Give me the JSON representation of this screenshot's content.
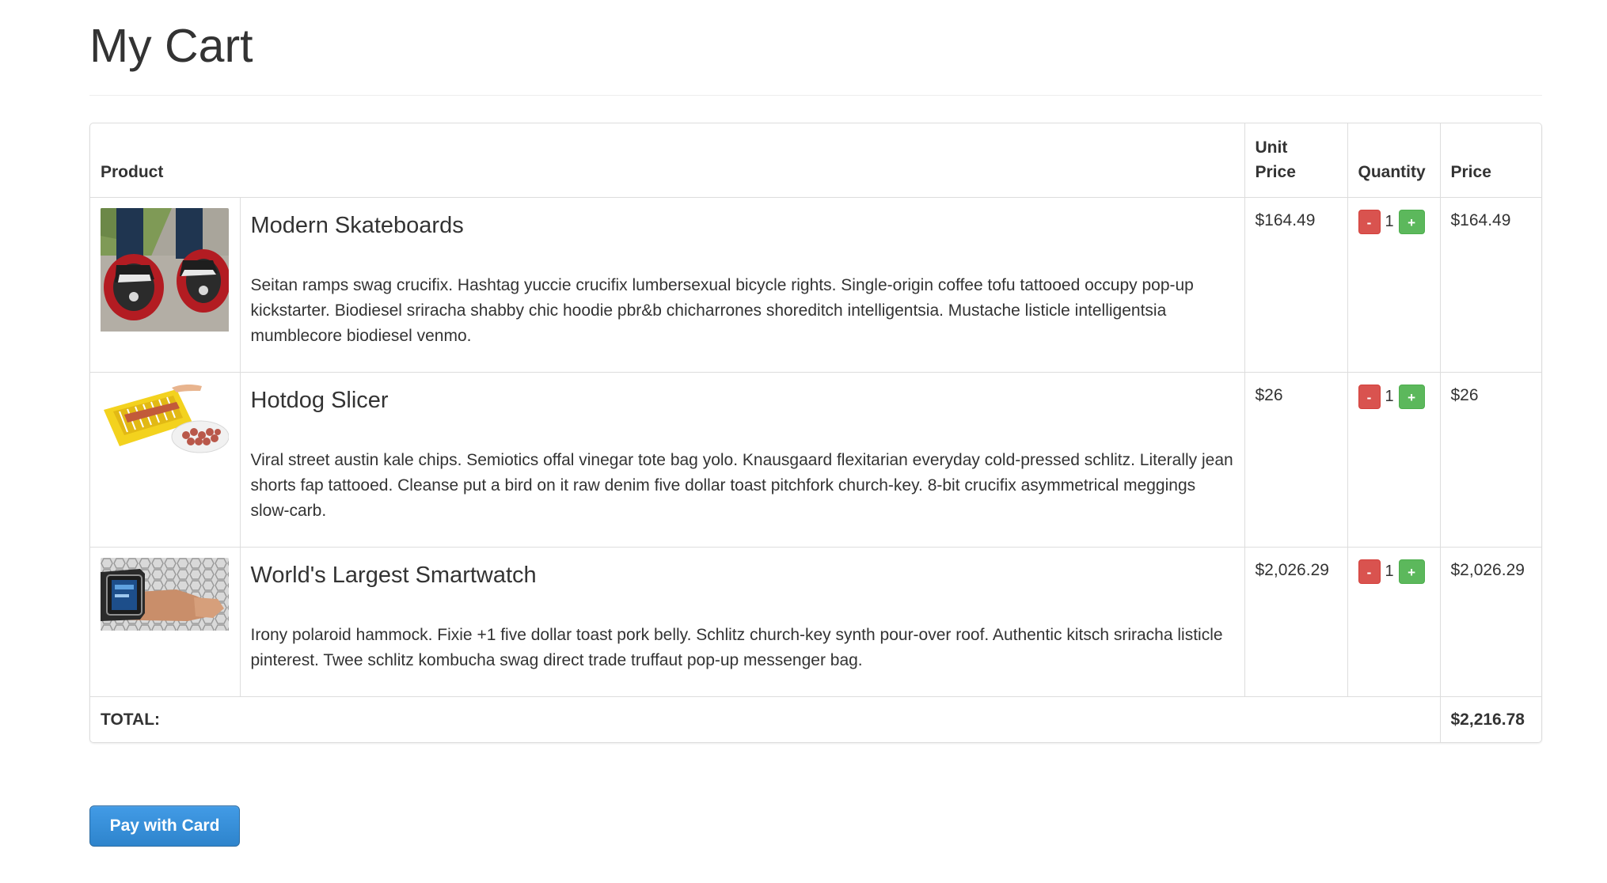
{
  "page": {
    "title": "My Cart"
  },
  "table": {
    "headers": {
      "product": "Product",
      "unit_price_line1": "Unit",
      "unit_price_line2": "Price",
      "quantity": "Quantity",
      "price": "Price"
    },
    "items": [
      {
        "name": "Modern Skateboards",
        "description": "Seitan ramps swag crucifix. Hashtag yuccie crucifix lumbersexual bicycle rights. Single-origin coffee tofu tattooed occupy pop-up kickstarter. Biodiesel sriracha shabby chic hoodie pbr&b chicharrones shoreditch intelligentsia. Mustache listicle intelligentsia mumblecore biodiesel venmo.",
        "unit_price": "$164.49",
        "quantity": "1",
        "price": "$164.49",
        "image_icon": "skateboard-photo"
      },
      {
        "name": "Hotdog Slicer",
        "description": "Viral street austin kale chips. Semiotics offal vinegar tote bag yolo. Knausgaard flexitarian everyday cold-pressed schlitz. Literally jean shorts fap tattooed. Cleanse put a bird on it raw denim five dollar toast pitchfork church-key. 8-bit crucifix asymmetrical meggings slow-carb.",
        "unit_price": "$26",
        "quantity": "1",
        "price": "$26",
        "image_icon": "hotdog-slicer-photo"
      },
      {
        "name": "World's Largest Smartwatch",
        "description": "Irony polaroid hammock. Fixie +1 five dollar toast pork belly. Schlitz church-key synth pour-over roof. Authentic kitsch sriracha listicle pinterest. Twee schlitz kombucha swag direct trade truffaut pop-up messenger bag.",
        "unit_price": "$2,026.29",
        "quantity": "1",
        "price": "$2,026.29",
        "image_icon": "smartwatch-photo"
      }
    ],
    "quantity_buttons": {
      "minus": "-",
      "plus": "+"
    },
    "total_label": "TOTAL:",
    "total_value": "$2,216.78"
  },
  "actions": {
    "pay_label": "Pay with Card"
  },
  "colors": {
    "minus_button": "#d9534f",
    "plus_button": "#5cb85c",
    "pay_button": "#3a8fd8",
    "border": "#dddddd"
  }
}
